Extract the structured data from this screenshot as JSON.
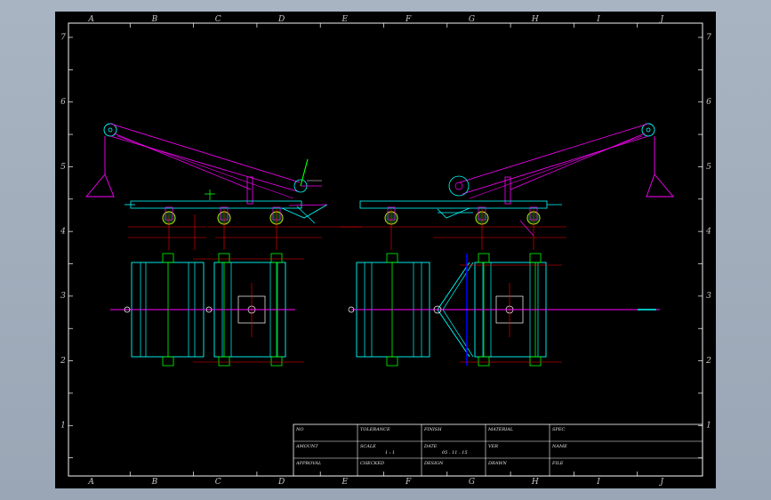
{
  "grid": {
    "columns": [
      "A",
      "B",
      "C",
      "D",
      "E",
      "F",
      "G",
      "H",
      "I",
      "J"
    ],
    "rows": [
      "7",
      "6",
      "5",
      "4",
      "3",
      "2",
      "1"
    ]
  },
  "title_block": {
    "r1": [
      "NO",
      "TOLERANCE",
      "FINISH",
      "MATERIAL",
      "SPEC"
    ],
    "r2": [
      "AMOUNT",
      "SCALE",
      "DATE",
      "VER",
      "NAME"
    ],
    "r2_values": {
      "scale": "1 : 1",
      "date": "05 . 11 . 15"
    },
    "r3": [
      "APPROVAL",
      "CHECKED",
      "DESIGN",
      "DRAWN",
      "FILE"
    ]
  },
  "colors": {
    "background": "#000000",
    "frame": "#ffffff",
    "cyan": "#00ffff",
    "magenta": "#ff00ff",
    "red": "#ff0000",
    "green": "#00ff00",
    "yellow": "#ffff00",
    "blue": "#0000ff"
  }
}
